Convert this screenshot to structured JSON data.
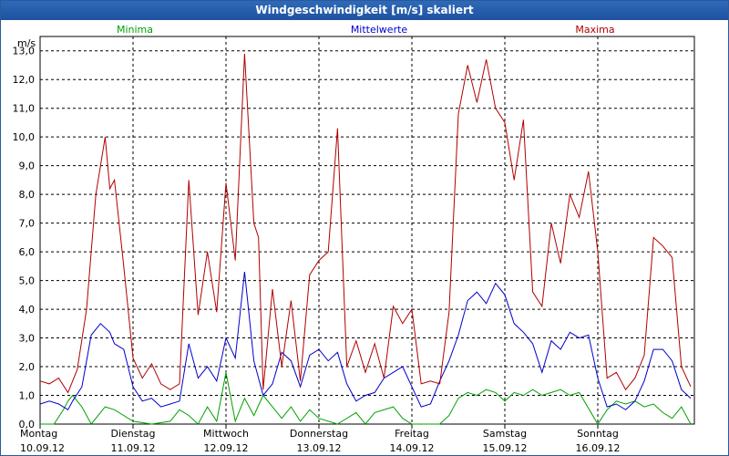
{
  "window": {
    "title": "Windgeschwindigkeit [m/s] skaliert"
  },
  "chart_data": {
    "type": "line",
    "unit": "m/s",
    "ylim": [
      0,
      13.5
    ],
    "yticks": [
      "0,0",
      "1,0",
      "2,0",
      "3,0",
      "4,0",
      "5,0",
      "6,0",
      "7,0",
      "8,0",
      "9,0",
      "10,0",
      "11,0",
      "12,0",
      "13,0"
    ],
    "x_days": [
      {
        "day": "Montag",
        "date": "10.09.12"
      },
      {
        "day": "Dienstag",
        "date": "11.09.12"
      },
      {
        "day": "Mittwoch",
        "date": "12.09.12"
      },
      {
        "day": "Donnerstag",
        "date": "13.09.12"
      },
      {
        "day": "Freitag",
        "date": "14.09.12"
      },
      {
        "day": "Samstag",
        "date": "15.09.12"
      },
      {
        "day": "Sonntag",
        "date": "16.09.12"
      }
    ],
    "grid": true,
    "series": [
      {
        "name": "Minima",
        "color": "#00a000",
        "points": [
          [
            0,
            0
          ],
          [
            0.15,
            0
          ],
          [
            0.25,
            0.5
          ],
          [
            0.3,
            0.8
          ],
          [
            0.35,
            1.0
          ],
          [
            0.45,
            0.6
          ],
          [
            0.55,
            0
          ],
          [
            0.7,
            0.6
          ],
          [
            0.8,
            0.5
          ],
          [
            1.0,
            0.1
          ],
          [
            1.2,
            0
          ],
          [
            1.4,
            0.1
          ],
          [
            1.5,
            0.5
          ],
          [
            1.6,
            0.3
          ],
          [
            1.7,
            0
          ],
          [
            1.8,
            0.6
          ],
          [
            1.9,
            0.1
          ],
          [
            2.0,
            1.8
          ],
          [
            2.1,
            0.1
          ],
          [
            2.2,
            0.9
          ],
          [
            2.3,
            0.3
          ],
          [
            2.4,
            1.0
          ],
          [
            2.5,
            0.6
          ],
          [
            2.6,
            0.2
          ],
          [
            2.7,
            0.6
          ],
          [
            2.8,
            0.1
          ],
          [
            2.9,
            0.5
          ],
          [
            3.0,
            0.2
          ],
          [
            3.2,
            0
          ],
          [
            3.4,
            0.4
          ],
          [
            3.5,
            0
          ],
          [
            3.6,
            0.4
          ],
          [
            3.8,
            0.6
          ],
          [
            3.9,
            0.2
          ],
          [
            4.0,
            0
          ],
          [
            4.3,
            0
          ],
          [
            4.4,
            0.3
          ],
          [
            4.5,
            0.9
          ],
          [
            4.6,
            1.1
          ],
          [
            4.7,
            1.0
          ],
          [
            4.8,
            1.2
          ],
          [
            4.9,
            1.1
          ],
          [
            5.0,
            0.8
          ],
          [
            5.1,
            1.1
          ],
          [
            5.2,
            1.0
          ],
          [
            5.3,
            1.2
          ],
          [
            5.4,
            1.0
          ],
          [
            5.5,
            1.1
          ],
          [
            5.6,
            1.2
          ],
          [
            5.7,
            1.0
          ],
          [
            5.8,
            1.1
          ],
          [
            6.0,
            0
          ],
          [
            6.1,
            0.5
          ],
          [
            6.2,
            0.8
          ],
          [
            6.3,
            0.7
          ],
          [
            6.4,
            0.8
          ],
          [
            6.5,
            0.6
          ],
          [
            6.6,
            0.7
          ],
          [
            6.7,
            0.4
          ],
          [
            6.8,
            0.2
          ],
          [
            6.9,
            0.6
          ],
          [
            7.0,
            0
          ]
        ]
      },
      {
        "name": "Mittelwerte",
        "color": "#0000cc",
        "points": [
          [
            0,
            0.7
          ],
          [
            0.1,
            0.8
          ],
          [
            0.2,
            0.7
          ],
          [
            0.3,
            0.5
          ],
          [
            0.35,
            0.8
          ],
          [
            0.45,
            1.3
          ],
          [
            0.55,
            3.1
          ],
          [
            0.65,
            3.5
          ],
          [
            0.75,
            3.2
          ],
          [
            0.8,
            2.8
          ],
          [
            0.9,
            2.6
          ],
          [
            1.0,
            1.3
          ],
          [
            1.1,
            0.8
          ],
          [
            1.2,
            0.9
          ],
          [
            1.3,
            0.6
          ],
          [
            1.4,
            0.7
          ],
          [
            1.5,
            0.8
          ],
          [
            1.6,
            2.8
          ],
          [
            1.7,
            1.6
          ],
          [
            1.8,
            2.0
          ],
          [
            1.9,
            1.5
          ],
          [
            2.0,
            3.0
          ],
          [
            2.1,
            2.3
          ],
          [
            2.2,
            5.3
          ],
          [
            2.3,
            2.2
          ],
          [
            2.35,
            1.6
          ],
          [
            2.4,
            1.0
          ],
          [
            2.5,
            1.4
          ],
          [
            2.6,
            2.5
          ],
          [
            2.7,
            2.2
          ],
          [
            2.8,
            1.3
          ],
          [
            2.9,
            2.4
          ],
          [
            3.0,
            2.6
          ],
          [
            3.1,
            2.2
          ],
          [
            3.2,
            2.5
          ],
          [
            3.3,
            1.4
          ],
          [
            3.4,
            0.8
          ],
          [
            3.5,
            1.0
          ],
          [
            3.6,
            1.1
          ],
          [
            3.7,
            1.6
          ],
          [
            3.8,
            1.8
          ],
          [
            3.9,
            2.0
          ],
          [
            4.0,
            1.3
          ],
          [
            4.1,
            0.6
          ],
          [
            4.2,
            0.7
          ],
          [
            4.3,
            1.5
          ],
          [
            4.4,
            2.2
          ],
          [
            4.5,
            3.1
          ],
          [
            4.6,
            4.3
          ],
          [
            4.7,
            4.6
          ],
          [
            4.8,
            4.2
          ],
          [
            4.9,
            4.9
          ],
          [
            5.0,
            4.5
          ],
          [
            5.1,
            3.5
          ],
          [
            5.2,
            3.2
          ],
          [
            5.3,
            2.8
          ],
          [
            5.4,
            1.8
          ],
          [
            5.5,
            2.9
          ],
          [
            5.6,
            2.6
          ],
          [
            5.7,
            3.2
          ],
          [
            5.8,
            3.0
          ],
          [
            5.9,
            3.1
          ],
          [
            6.0,
            1.6
          ],
          [
            6.1,
            0.6
          ],
          [
            6.2,
            0.7
          ],
          [
            6.3,
            0.5
          ],
          [
            6.4,
            0.8
          ],
          [
            6.5,
            1.5
          ],
          [
            6.6,
            2.6
          ],
          [
            6.7,
            2.6
          ],
          [
            6.8,
            2.2
          ],
          [
            6.9,
            1.2
          ],
          [
            7.0,
            0.9
          ]
        ]
      },
      {
        "name": "Maxima",
        "color": "#b00000",
        "points": [
          [
            0,
            1.5
          ],
          [
            0.1,
            1.4
          ],
          [
            0.2,
            1.6
          ],
          [
            0.3,
            1.1
          ],
          [
            0.4,
            1.9
          ],
          [
            0.5,
            4.0
          ],
          [
            0.6,
            8.0
          ],
          [
            0.7,
            10.0
          ],
          [
            0.75,
            8.2
          ],
          [
            0.8,
            8.5
          ],
          [
            0.9,
            5.5
          ],
          [
            1.0,
            2.3
          ],
          [
            1.1,
            1.6
          ],
          [
            1.2,
            2.1
          ],
          [
            1.3,
            1.4
          ],
          [
            1.4,
            1.2
          ],
          [
            1.5,
            1.4
          ],
          [
            1.6,
            8.5
          ],
          [
            1.7,
            3.8
          ],
          [
            1.8,
            6.0
          ],
          [
            1.9,
            3.9
          ],
          [
            2.0,
            8.4
          ],
          [
            2.1,
            5.7
          ],
          [
            2.2,
            12.9
          ],
          [
            2.3,
            7.0
          ],
          [
            2.35,
            6.5
          ],
          [
            2.4,
            1.2
          ],
          [
            2.5,
            4.7
          ],
          [
            2.6,
            2.0
          ],
          [
            2.7,
            4.3
          ],
          [
            2.8,
            1.5
          ],
          [
            2.9,
            5.2
          ],
          [
            3.0,
            5.7
          ],
          [
            3.1,
            6.0
          ],
          [
            3.2,
            10.3
          ],
          [
            3.3,
            2.0
          ],
          [
            3.4,
            2.9
          ],
          [
            3.5,
            1.8
          ],
          [
            3.6,
            2.8
          ],
          [
            3.7,
            1.6
          ],
          [
            3.8,
            4.1
          ],
          [
            3.9,
            3.5
          ],
          [
            4.0,
            4.0
          ],
          [
            4.1,
            1.4
          ],
          [
            4.2,
            1.5
          ],
          [
            4.3,
            1.4
          ],
          [
            4.4,
            3.9
          ],
          [
            4.5,
            10.8
          ],
          [
            4.6,
            12.5
          ],
          [
            4.7,
            11.2
          ],
          [
            4.8,
            12.7
          ],
          [
            4.9,
            11.0
          ],
          [
            5.0,
            10.5
          ],
          [
            5.1,
            8.5
          ],
          [
            5.2,
            10.6
          ],
          [
            5.3,
            4.6
          ],
          [
            5.4,
            4.1
          ],
          [
            5.5,
            7.0
          ],
          [
            5.6,
            5.6
          ],
          [
            5.7,
            8.0
          ],
          [
            5.8,
            7.2
          ],
          [
            5.9,
            8.8
          ],
          [
            6.0,
            6.0
          ],
          [
            6.1,
            1.6
          ],
          [
            6.2,
            1.8
          ],
          [
            6.3,
            1.2
          ],
          [
            6.4,
            1.6
          ],
          [
            6.5,
            2.4
          ],
          [
            6.6,
            6.5
          ],
          [
            6.7,
            6.2
          ],
          [
            6.8,
            5.8
          ],
          [
            6.9,
            2.0
          ],
          [
            7.0,
            1.3
          ]
        ]
      }
    ]
  }
}
